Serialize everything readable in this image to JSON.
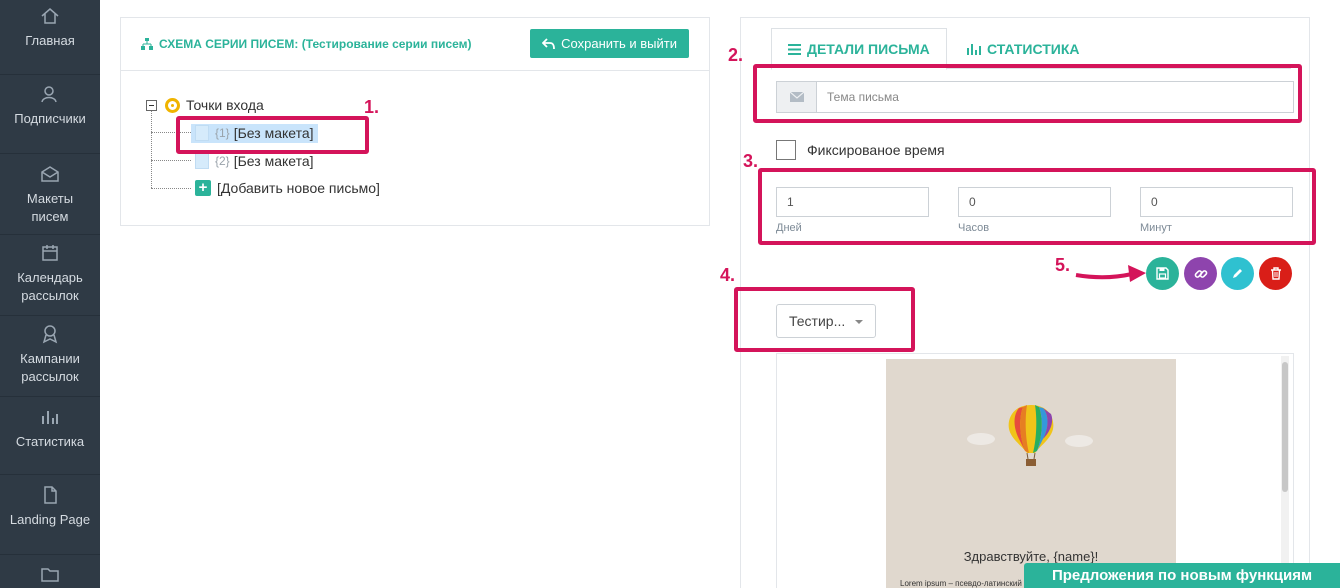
{
  "sidebar": {
    "items": [
      {
        "label": "Главная",
        "icon": "home-icon"
      },
      {
        "label": "Подписчики",
        "icon": "subscribers-icon"
      },
      {
        "label": "Макеты писем",
        "icon": "mail-template-icon"
      },
      {
        "label": "Календарь рассылок",
        "icon": "calendar-icon"
      },
      {
        "label": "Кампании рассылок",
        "icon": "campaign-icon"
      },
      {
        "label": "Статистика",
        "icon": "statistics-icon"
      },
      {
        "label": "Landing Page",
        "icon": "page-icon"
      },
      {
        "label": "",
        "icon": "folder-icon"
      }
    ]
  },
  "schema": {
    "title": "СХЕМА СЕРИИ ПИСЕМ: (Тестирование серии писем)",
    "save_exit_label": "Сохранить и выйти",
    "tree": {
      "root_label": "Точки входа",
      "letters": [
        {
          "num": "{1}",
          "label": "[Без макета]",
          "selected": true
        },
        {
          "num": "{2}",
          "label": "[Без макета]",
          "selected": false
        }
      ],
      "add_label": "[Добавить новое письмо]"
    }
  },
  "details": {
    "tabs": [
      {
        "label": "ДЕТАЛИ ПИСЬМА",
        "icon": "list-icon",
        "active": true
      },
      {
        "label": "СТАТИСТИКА",
        "icon": "bar-chart-icon",
        "active": false
      }
    ],
    "subject_placeholder": "Тема письма",
    "subject_value": "",
    "fixed_time_label": "Фиксированое время",
    "fixed_time_checked": false,
    "delay": {
      "days": {
        "value": "1",
        "caption": "Дней"
      },
      "hours": {
        "value": "0",
        "caption": "Часов"
      },
      "minutes": {
        "value": "0",
        "caption": "Минут"
      }
    },
    "actions": [
      {
        "name": "save",
        "icon": "save-icon",
        "color": "#2bb39a"
      },
      {
        "name": "link",
        "icon": "link-icon",
        "color": "#8e44ad"
      },
      {
        "name": "edit",
        "icon": "pencil-icon",
        "color": "#2fc1d0"
      },
      {
        "name": "delete",
        "icon": "trash-icon",
        "color": "#d91e18"
      }
    ],
    "template_select": "Тестир...",
    "preview": {
      "greeting": "Здравствуйте, {name}!",
      "lorem": "Lorem ipsum – псевдо-латинский т"
    }
  },
  "annotations": [
    "1.",
    "2.",
    "3.",
    "4.",
    "5."
  ],
  "feedback_label": "Предложения по новым функциям",
  "colors": {
    "accent": "#2bb39a",
    "annotation": "#d4145a",
    "sidebar_bg": "#2f3a45"
  }
}
